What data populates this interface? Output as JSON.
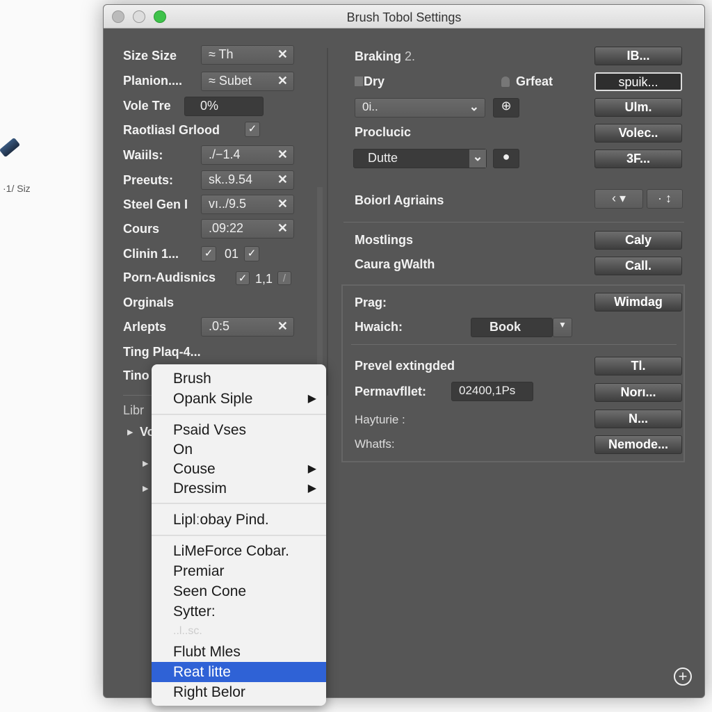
{
  "desktop": {
    "label": "·1/ Siz"
  },
  "window": {
    "title": "Brush Tobol Settings"
  },
  "left": {
    "rows": [
      {
        "label": "Size Size",
        "value": "≈ Th"
      },
      {
        "label": "Planion....",
        "value": "≈ Subet"
      },
      {
        "label": "Vole Tre",
        "value": "0%"
      },
      {
        "label": "Raotliasl Grlood",
        "checked": true
      },
      {
        "label": "Waiils:",
        "value": "./−1.4"
      },
      {
        "label": "Preeuts:",
        "value": "sk..9.54"
      },
      {
        "label": "Steel Gen I",
        "value": "vı../9.5"
      },
      {
        "label": "Cours",
        "value": ".09:22"
      },
      {
        "label": "Clinin 1...",
        "value": "01"
      },
      {
        "label": "Porn-Audisnics",
        "value": "1,1"
      },
      {
        "label": "Orginals"
      },
      {
        "label": "Arlepts",
        "value": ".0:5"
      },
      {
        "label": "Ting Plaq-4..."
      },
      {
        "label": "Tino"
      }
    ],
    "library": "Libr",
    "tree_item": "Vo"
  },
  "right": {
    "braking": "Braking",
    "braking_num": "2.",
    "dry": "Dry",
    "grfeat": "Grfeat",
    "select1": "0i..",
    "proclucic": "Proclucic",
    "select2": "Dutte",
    "boiorl": "Boiorl Agriains",
    "mostlings": "Mostlings",
    "caura": "Caura gWalth",
    "prag": "Prag:",
    "hwaich": "Hwaich:",
    "book": "Book",
    "prevel": "Prevel extingded",
    "permav": "Permavfllet:",
    "permav_value": "02400,1Ps",
    "hayturie": "Hayturie :",
    "whatfs": "Whatfs:",
    "buttons": [
      "IB...",
      "spuik...",
      "Ulm.",
      "Volec..",
      "3F...",
      "Caly",
      "Call.",
      "Wimdag",
      "Tl.",
      "Norı...",
      "N...",
      "Nemode..."
    ]
  },
  "menu": {
    "items": [
      "Brush",
      "Opank Siple",
      "Psaid Vses",
      "On",
      "Couse",
      "Dressim",
      "Liplːobay Pind.",
      "LiMeForce Cobar.",
      "Premiar",
      "Seen Cone",
      "Sytter:",
      "..l..sc.",
      "Flubt Mles",
      "Reat litte",
      "Right Belor"
    ],
    "selected": "Reat litte",
    "accent": "#2f62d6"
  }
}
